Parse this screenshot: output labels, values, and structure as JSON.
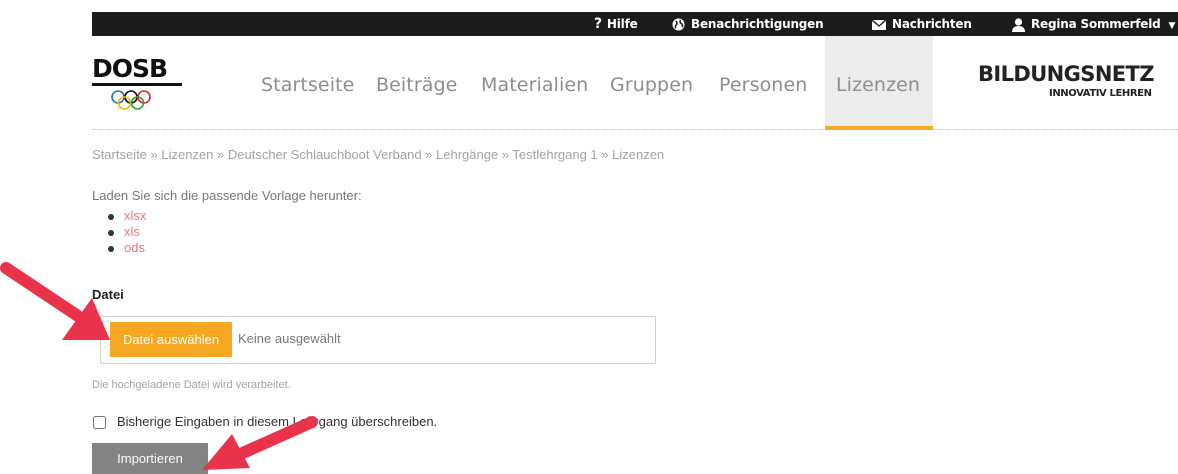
{
  "topbar": {
    "help": "Hilfe",
    "notifications": "Benachrichtigungen",
    "messages": "Nachrichten",
    "user": "Regina Sommerfeld"
  },
  "logo": {
    "text": "DOSB"
  },
  "nav": {
    "items": [
      "Startseite",
      "Beiträge",
      "Materialien",
      "Gruppen",
      "Personen",
      "Lizenzen"
    ],
    "active": "Lizenzen"
  },
  "brand": {
    "title": "BILDUNGSNETZ",
    "subtitle": "INNOVATIV LEHREN"
  },
  "breadcrumb": "Startseite » Lizenzen » Deutscher Schlauchboot Verband » Lehrgänge » Testlehrgang 1 » Lizenzen",
  "download": {
    "intro": "Laden Sie sich die passende Vorlage herunter:",
    "links": [
      "xlsx",
      "xls",
      "ods"
    ]
  },
  "file": {
    "label": "Datei",
    "button": "Datei auswählen",
    "status": "Keine ausgewählt",
    "help": "Die hochgeladene Datei wird verarbeitet."
  },
  "overwrite": {
    "label": "Bisherige Eingaben in diesem Lehrgang überschreiben.",
    "checked": false
  },
  "import_button": "Importieren",
  "colors": {
    "accent": "#f7a823",
    "link": "#e57b79",
    "arrow": "#e8334a",
    "topbar": "#1b1b1b"
  }
}
